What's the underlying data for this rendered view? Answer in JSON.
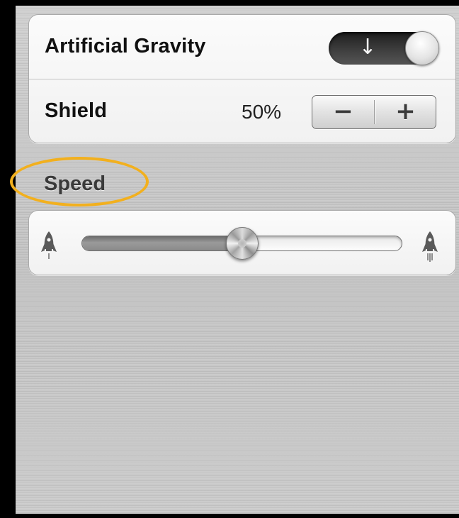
{
  "settings": {
    "artificial_gravity": {
      "label": "Artificial Gravity",
      "toggle_icon": "down-arrow-icon",
      "toggle_glyph": "↓",
      "is_on": true
    },
    "shield": {
      "label": "Shield",
      "value": "50%",
      "minus_glyph": "−",
      "plus_glyph": "+"
    }
  },
  "speed": {
    "header": "Speed",
    "slider_value": 0.5,
    "min_icon": "rocket-slow-icon",
    "max_icon": "rocket-fast-icon"
  },
  "colors": {
    "highlight": "#f2b01e",
    "background": "#c6c6c6"
  }
}
